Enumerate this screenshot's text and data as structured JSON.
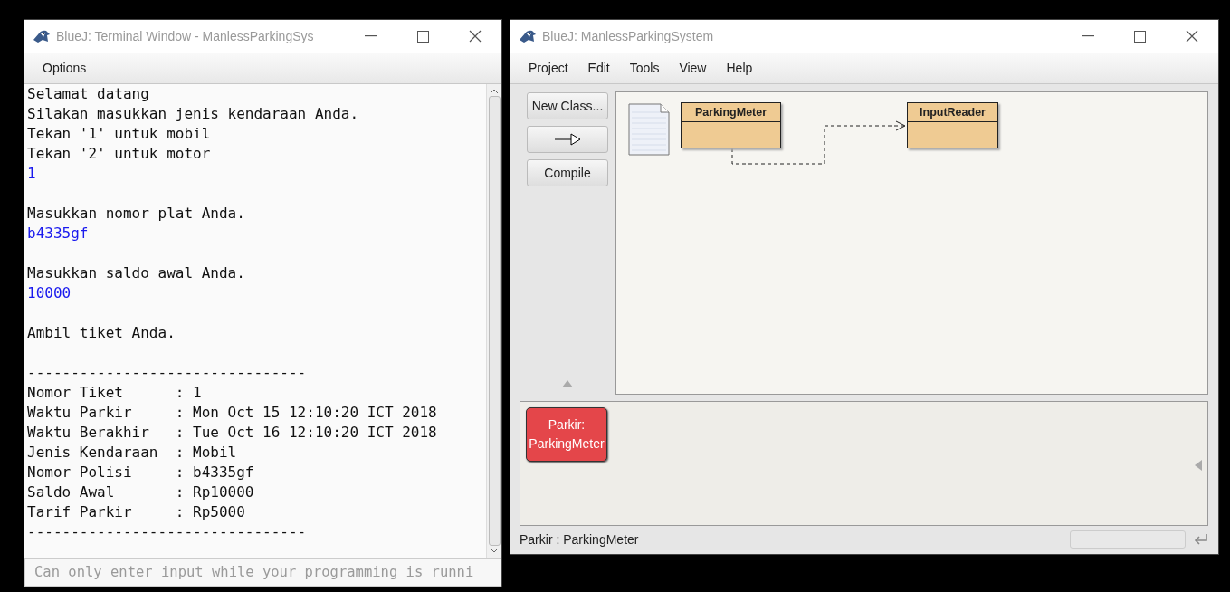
{
  "terminal": {
    "title": "BlueJ: Terminal Window - ManlessParkingSys",
    "menu": [
      "Options"
    ],
    "lines": [
      {
        "kind": "output",
        "text": "Selamat datang"
      },
      {
        "kind": "output",
        "text": "Silakan masukkan jenis kendaraan Anda."
      },
      {
        "kind": "output",
        "text": "Tekan '1' untuk mobil"
      },
      {
        "kind": "output",
        "text": "Tekan '2' untuk motor"
      },
      {
        "kind": "input",
        "text": "1"
      },
      {
        "kind": "blank"
      },
      {
        "kind": "output",
        "text": "Masukkan nomor plat Anda."
      },
      {
        "kind": "input",
        "text": "b4335gf"
      },
      {
        "kind": "blank"
      },
      {
        "kind": "output",
        "text": "Masukkan saldo awal Anda."
      },
      {
        "kind": "input",
        "text": "10000"
      },
      {
        "kind": "blank"
      },
      {
        "kind": "output",
        "text": "Ambil tiket Anda."
      },
      {
        "kind": "blank"
      },
      {
        "kind": "output",
        "text": "--------------------------------"
      },
      {
        "kind": "output",
        "text": "Nomor Tiket      : 1"
      },
      {
        "kind": "output",
        "text": "Waktu Parkir     : Mon Oct 15 12:10:20 ICT 2018"
      },
      {
        "kind": "output",
        "text": "Waktu Berakhir   : Tue Oct 16 12:10:20 ICT 2018"
      },
      {
        "kind": "output",
        "text": "Jenis Kendaraan  : Mobil"
      },
      {
        "kind": "output",
        "text": "Nomor Polisi     : b4335gf"
      },
      {
        "kind": "output",
        "text": "Saldo Awal       : Rp10000"
      },
      {
        "kind": "output",
        "text": "Tarif Parkir     : Rp5000"
      },
      {
        "kind": "output",
        "text": "--------------------------------"
      }
    ],
    "input_placeholder": "Can only enter input while your programming is runni"
  },
  "main": {
    "title": "BlueJ:  ManlessParkingSystem",
    "menu": [
      "Project",
      "Edit",
      "Tools",
      "View",
      "Help"
    ],
    "tools": [
      {
        "kind": "text",
        "label": "New Class..."
      },
      {
        "kind": "arrow"
      },
      {
        "kind": "text",
        "label": "Compile"
      }
    ],
    "classes": [
      {
        "name": "ParkingMeter"
      },
      {
        "name": "InputReader"
      }
    ],
    "objects": [
      {
        "name": "Parkir:",
        "type": "ParkingMeter"
      }
    ],
    "status": "Parkir : ParkingMeter"
  }
}
